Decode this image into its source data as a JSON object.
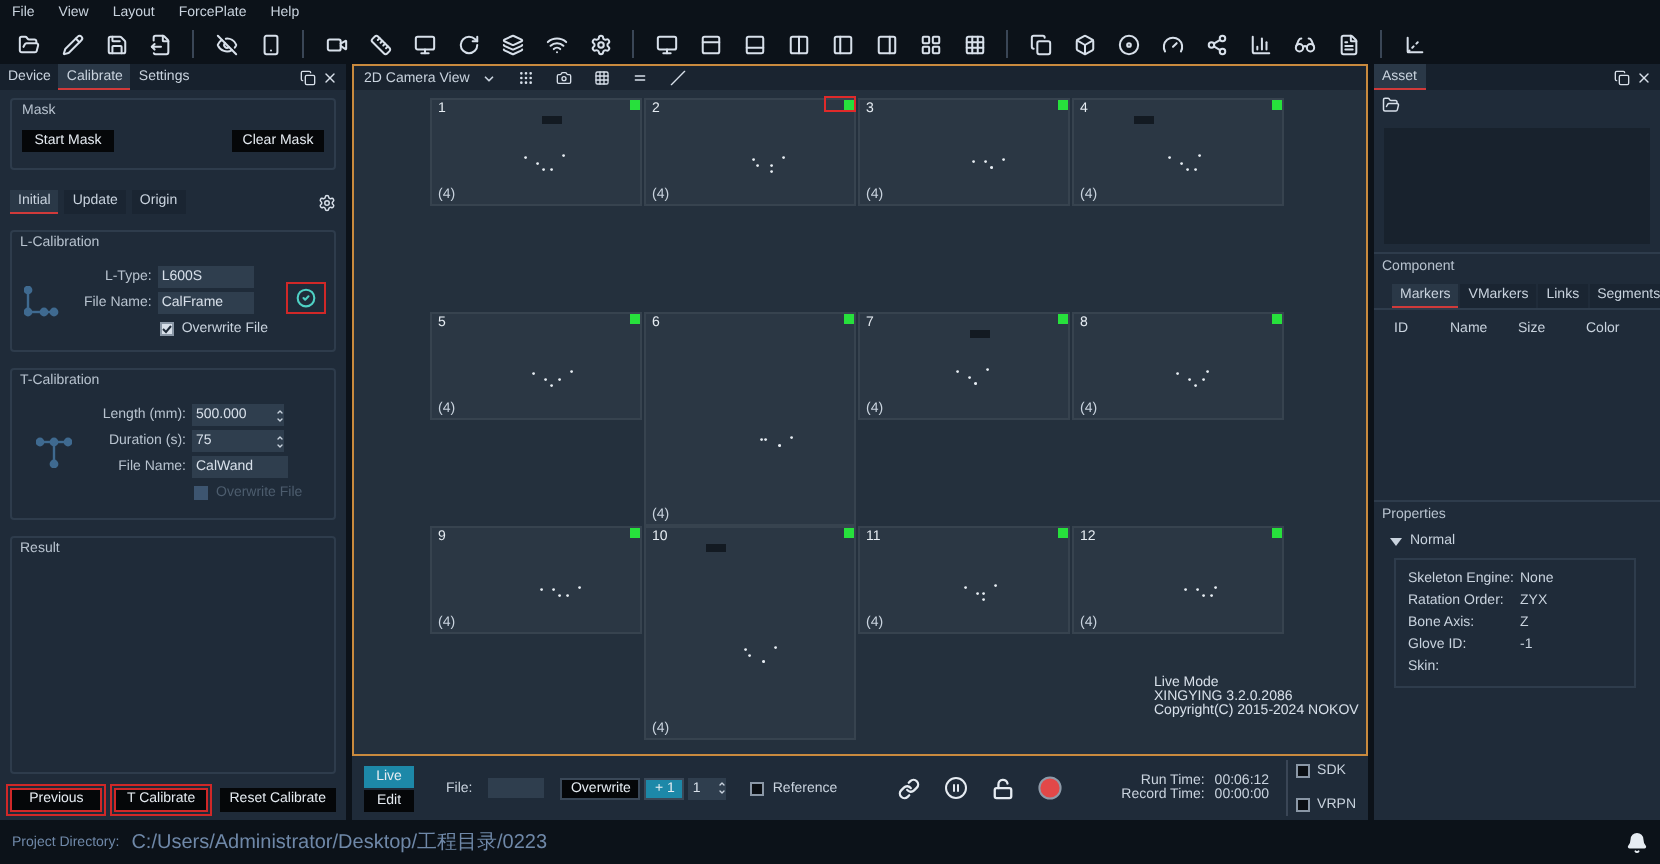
{
  "menu": [
    "File",
    "View",
    "Layout",
    "ForcePlate",
    "Help"
  ],
  "left_panel": {
    "tabs": [
      {
        "label": "Device",
        "selected": false
      },
      {
        "label": "Calibrate",
        "selected": true
      },
      {
        "label": "Settings",
        "selected": false
      }
    ],
    "mask": {
      "title": "Mask",
      "buttons": [
        "Start Mask",
        "Clear Mask"
      ]
    },
    "sub_tabs": [
      {
        "label": "Initial",
        "selected": true
      },
      {
        "label": "Update",
        "selected": false
      },
      {
        "label": "Origin",
        "selected": false
      }
    ],
    "l_calibration": {
      "title": "L-Calibration",
      "fields": [
        {
          "label": "L-Type:",
          "value": "L600S",
          "kind": "text"
        },
        {
          "label": "File Name:",
          "value": "CalFrame",
          "kind": "text"
        }
      ],
      "apply_highlighted": true,
      "overwrite": {
        "label": "Overwrite File",
        "checked": true,
        "disabled": false
      }
    },
    "t_calibration": {
      "title": "T-Calibration",
      "fields": [
        {
          "label": "Length (mm):",
          "value": "500.000",
          "kind": "spin"
        },
        {
          "label": "Duration (s):",
          "value": "75",
          "kind": "spin"
        },
        {
          "label": "File Name:",
          "value": "CalWand",
          "kind": "text"
        }
      ],
      "overwrite": {
        "label": "Overwrite File",
        "checked": false,
        "disabled": true
      }
    },
    "result": {
      "title": "Result"
    },
    "buttons": [
      {
        "label": "Previous",
        "highlighted": true
      },
      {
        "label": "T Calibrate",
        "highlighted": true
      },
      {
        "label": "Reset Calibrate",
        "highlighted": false
      }
    ]
  },
  "camera_view": {
    "view_select": "2D Camera View",
    "cells": [
      {
        "number": "1",
        "footer": "(4)",
        "tall": false,
        "highlighted": false
      },
      {
        "number": "2",
        "footer": "(4)",
        "tall": false,
        "highlighted": true
      },
      {
        "number": "3",
        "footer": "(4)",
        "tall": false,
        "highlighted": false
      },
      {
        "number": "4",
        "footer": "(4)",
        "tall": false,
        "highlighted": false
      },
      {
        "number": "5",
        "footer": "(4)",
        "tall": false,
        "highlighted": false
      },
      {
        "number": "6",
        "footer": "(4)",
        "tall": true,
        "highlighted": false
      },
      {
        "number": "7",
        "footer": "(4)",
        "tall": false,
        "highlighted": false
      },
      {
        "number": "8",
        "footer": "(4)",
        "tall": false,
        "highlighted": false
      },
      {
        "number": "9",
        "footer": "(4)",
        "tall": false,
        "highlighted": false
      },
      {
        "number": "10",
        "footer": "(4)",
        "tall": true,
        "highlighted": false
      },
      {
        "number": "11",
        "footer": "(4)",
        "tall": false,
        "highlighted": false
      },
      {
        "number": "12",
        "footer": "(4)",
        "tall": false,
        "highlighted": false
      }
    ],
    "info": [
      "Live Mode",
      "XINGYING 3.2.0.2086",
      "Copyright(C) 2015-2024 NOKOV"
    ]
  },
  "controls": {
    "modes": [
      {
        "label": "Live",
        "selected": true
      },
      {
        "label": "Edit",
        "selected": false
      }
    ],
    "file_label": "File:",
    "overwrite": "Overwrite",
    "increment": "+ 1",
    "take": "1",
    "reference": {
      "label": "Reference",
      "checked": false
    },
    "times": [
      {
        "label": "Run Time:",
        "value": "00:06:12"
      },
      {
        "label": "Record Time:",
        "value": "00:00:00"
      }
    ],
    "outputs": [
      {
        "label": "SDK",
        "checked": false
      },
      {
        "label": "VRPN",
        "checked": false
      }
    ]
  },
  "right_panel": {
    "tabs": [
      {
        "label": "Asset",
        "selected": true
      }
    ],
    "component_title": "Component",
    "component_tabs": [
      {
        "label": "Markers",
        "selected": true
      },
      {
        "label": "VMarkers",
        "selected": false
      },
      {
        "label": "Links",
        "selected": false
      },
      {
        "label": "Segments",
        "selected": false
      }
    ],
    "columns": [
      "ID",
      "Name",
      "Size",
      "Color"
    ],
    "properties_title": "Properties",
    "group": {
      "label": "Normal",
      "expanded": true
    },
    "properties": [
      {
        "label": "Skeleton Engine:",
        "value": "None"
      },
      {
        "label": "Ratation Order:",
        "value": "ZYX"
      },
      {
        "label": "Bone Axis:",
        "value": "Z"
      },
      {
        "label": "Glove ID:",
        "value": "-1"
      },
      {
        "label": "Skin:"
      }
    ]
  },
  "status_bar": {
    "label": "Project Directory:",
    "path": "C:/Users/Administrator/Desktop/工程目录/0223"
  }
}
